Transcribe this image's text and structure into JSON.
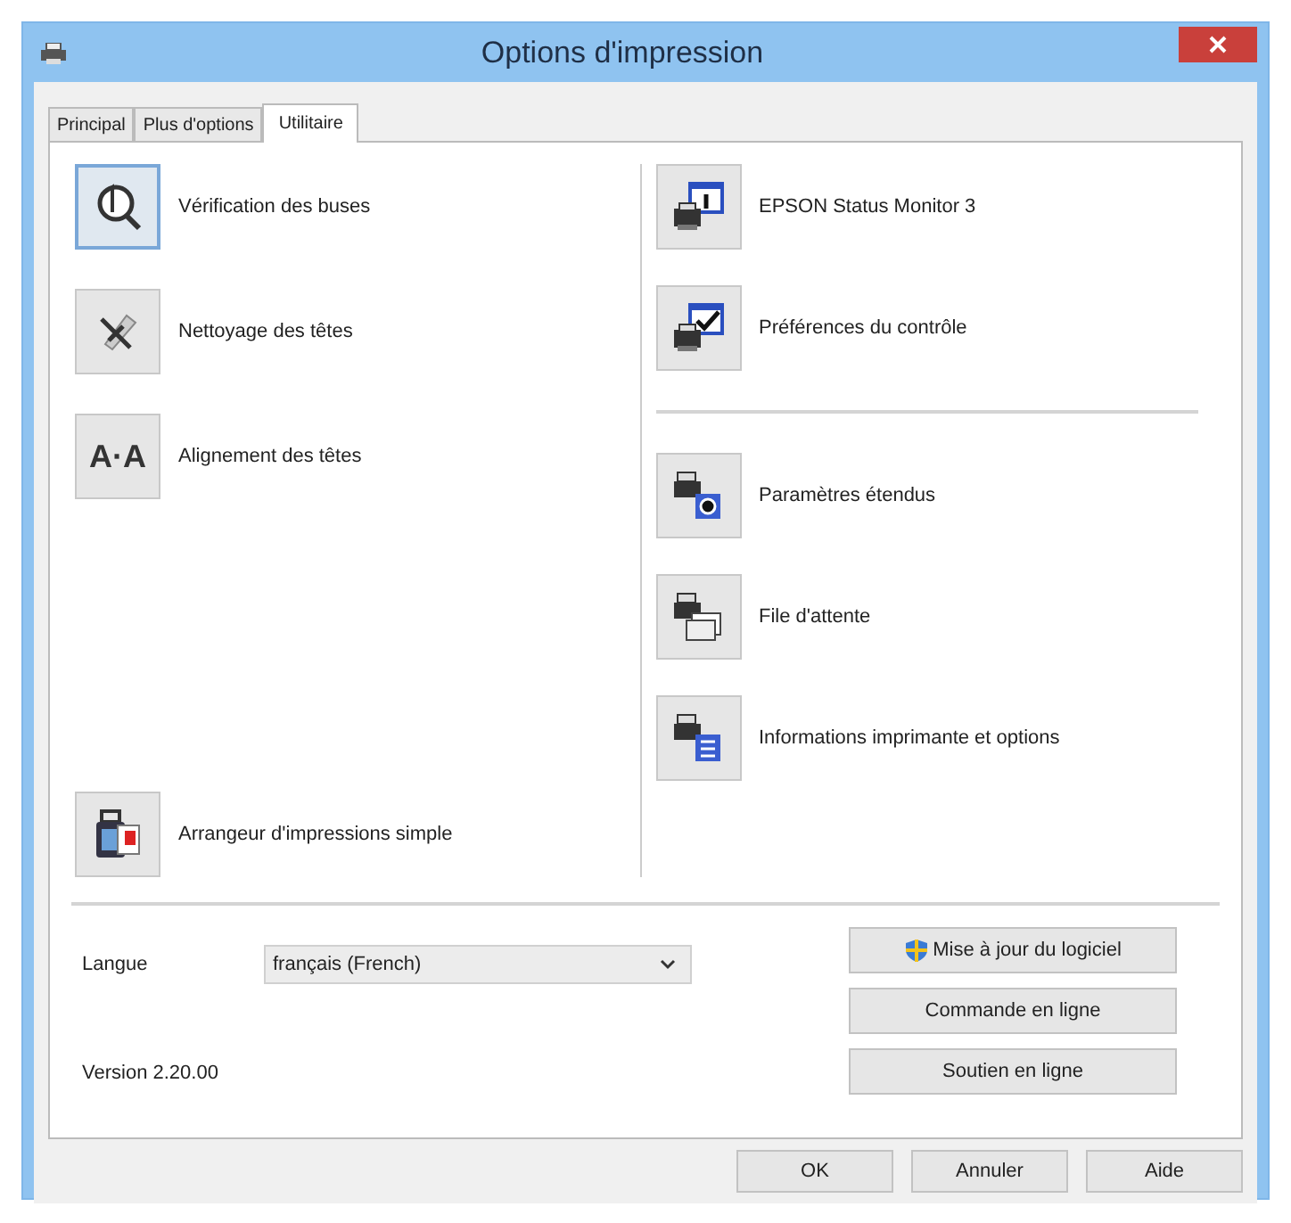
{
  "window": {
    "title": "Options d'impression"
  },
  "tabs": [
    {
      "label": "Principal",
      "selected": false
    },
    {
      "label": "Plus d'options",
      "selected": false
    },
    {
      "label": "Utilitaire",
      "selected": true
    }
  ],
  "left_tools": {
    "top": [
      {
        "label": "Vérification des buses",
        "selected": true
      },
      {
        "label": "Nettoyage des têtes",
        "selected": false
      },
      {
        "label": "Alignement des têtes",
        "selected": false,
        "icon_text": "A·A"
      }
    ],
    "bottom": [
      {
        "label": "Arrangeur d'impressions simple",
        "selected": false
      }
    ]
  },
  "right_tools": {
    "top": [
      {
        "label": "EPSON Status Monitor 3",
        "selected": false
      },
      {
        "label": "Préférences du contrôle",
        "selected": false
      }
    ],
    "bottom": [
      {
        "label": "Paramètres étendus",
        "selected": false
      },
      {
        "label": "File d'attente",
        "selected": false
      },
      {
        "label": "Informations imprimante et options",
        "selected": false
      }
    ]
  },
  "language": {
    "label": "Langue",
    "value": "français (French)"
  },
  "version": "Version 2.20.00",
  "side_buttons": [
    "Mise à jour du logiciel",
    "Commande en ligne",
    "Soutien en ligne"
  ],
  "buttons": [
    "OK",
    "Annuler",
    "Aide"
  ]
}
